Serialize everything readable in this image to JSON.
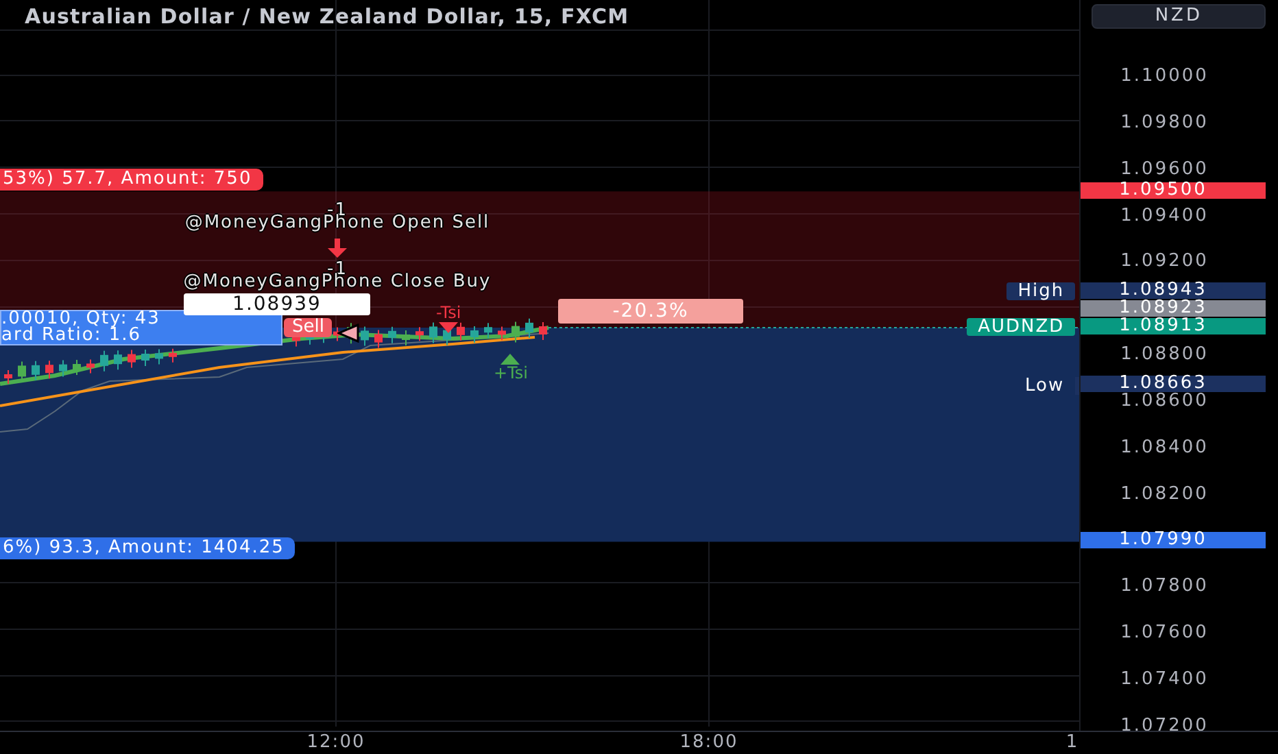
{
  "title": "Australian Dollar / New Zealand Dollar, 15, FXCM",
  "currency_button": "NZD",
  "price_ticks": [
    "1.10000",
    "1.09800",
    "1.09600",
    "1.09400",
    "1.09200",
    "1.08800",
    "1.08600",
    "1.08400",
    "1.08200",
    "1.07800",
    "1.07600",
    "1.07400",
    "1.07200"
  ],
  "price_tags": [
    {
      "label": "1.09500",
      "color": "#f23645"
    },
    {
      "label": "1.08943",
      "color": "#1c3160"
    },
    {
      "label": "1.08923",
      "color": "#868993"
    },
    {
      "label": "1.08913",
      "color": "#089981"
    },
    {
      "label": "1.08663",
      "color": "#1c3160"
    },
    {
      "label": "1.07990",
      "color": "#2f6fe8"
    }
  ],
  "line_labels": [
    {
      "text": "High",
      "kind": "box",
      "color": "#1c3160"
    },
    {
      "text": "AUDNZD",
      "kind": "box",
      "color": "#089981"
    },
    {
      "text": "Low",
      "kind": "plain",
      "color": "#1c3160"
    }
  ],
  "trade": {
    "stop_label": "53%) 57.7, Amount: 750",
    "target_label": "6%) 93.3, Amount: 1404.25",
    "entry_lines": [
      ".00010, Qty: 43",
      "ard Ratio: 1.6"
    ],
    "price_box": "1.08939",
    "side_badge": "Sell",
    "change_badge": "-20.3%"
  },
  "signals": [
    {
      "kind": "count",
      "text": "-1"
    },
    {
      "kind": "note",
      "text": "@MoneyGangPhone Open Sell"
    },
    {
      "kind": "arrow"
    },
    {
      "kind": "count",
      "text": "-1"
    },
    {
      "kind": "note",
      "text": "@MoneyGangPhone Close Buy"
    }
  ],
  "tsi_marks": [
    {
      "text": "-Tsi",
      "kind": "down"
    },
    {
      "text": "+Tsi",
      "kind": "up"
    }
  ],
  "time_labels": [
    "12:00",
    "18:00",
    "1"
  ]
}
